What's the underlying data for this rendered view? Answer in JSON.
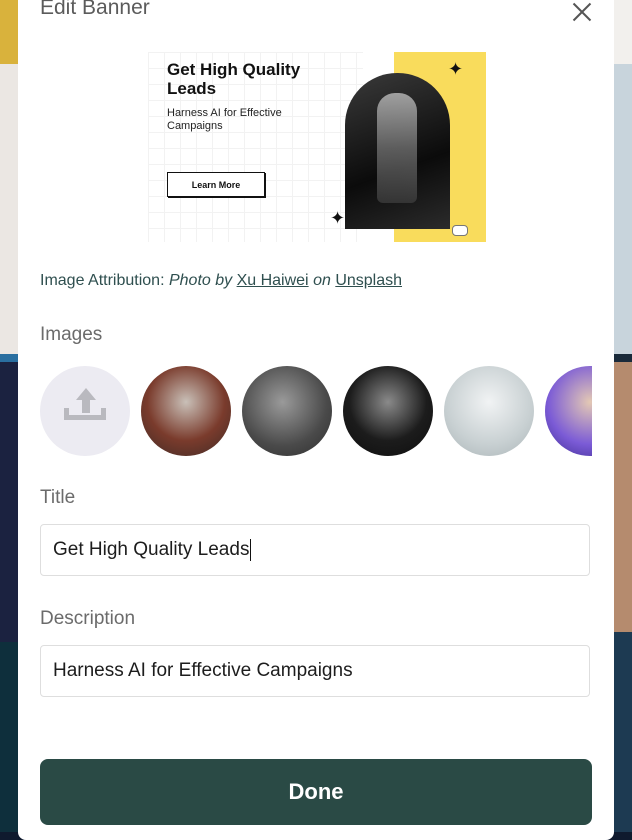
{
  "modal": {
    "title": "Edit Banner",
    "close_icon": "close-icon"
  },
  "banner_preview": {
    "headline": "Get High Quality Leads",
    "subtext": "Harness AI for Effective Campaigns",
    "cta_label": "Learn More",
    "accent_color": "#f9dc5c"
  },
  "attribution": {
    "prefix": "Image Attribution:",
    "photo_by": "Photo by",
    "author": "Xu Haiwei",
    "on": "on",
    "source": "Unsplash"
  },
  "images": {
    "label": "Images",
    "upload_icon": "upload-icon",
    "thumbnails": [
      {
        "name": "robot-in-red-chair"
      },
      {
        "name": "metal-robot"
      },
      {
        "name": "black-robot"
      },
      {
        "name": "white-robot-arm"
      },
      {
        "name": "vr-headset-person"
      }
    ]
  },
  "title_field": {
    "label": "Title",
    "value": "Get High Quality Leads"
  },
  "description_field": {
    "label": "Description",
    "value": "Harness AI for Effective Campaigns"
  },
  "done_button": {
    "label": "Done",
    "color": "#2a4a45"
  }
}
